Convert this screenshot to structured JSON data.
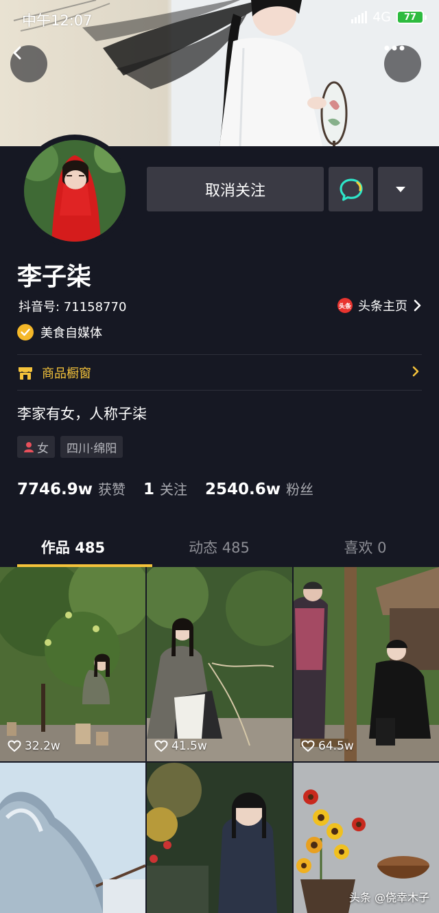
{
  "status_bar": {
    "time": "中午12:07",
    "network": "4G",
    "battery": "77"
  },
  "header": {
    "back_icon": "chevron-left-icon",
    "more_icon": "more-dots-icon"
  },
  "profile": {
    "name": "李子柒",
    "douyin_id": "抖音号: 71158770",
    "toutiao_badge": "头条",
    "toutiao_label": "头条主页",
    "verified_label": "美食自媒体",
    "unfollow_label": "取消关注",
    "shop_label": "商品橱窗",
    "bio": "李家有女，人称子柒",
    "tags": {
      "gender": "女",
      "location": "四川·绵阳"
    },
    "stats": {
      "likes_num": "7746.9w",
      "likes_label": "获赞",
      "following_num": "1",
      "following_label": "关注",
      "followers_num": "2540.6w",
      "followers_label": "粉丝"
    }
  },
  "tabs": [
    {
      "label": "作品 485",
      "active": true
    },
    {
      "label": "动态 485",
      "active": false
    },
    {
      "label": "喜欢 0",
      "active": false
    }
  ],
  "videos": [
    {
      "likes": "32.2w"
    },
    {
      "likes": "41.5w"
    },
    {
      "likes": "64.5w"
    },
    {
      "likes": ""
    },
    {
      "likes": ""
    },
    {
      "likes": ""
    }
  ],
  "watermark": "头条 @侥幸木子",
  "colors": {
    "background": "#161823",
    "accent": "#f5c33b",
    "button": "#3a3a44",
    "chat_icon": "#2ee6c9"
  }
}
